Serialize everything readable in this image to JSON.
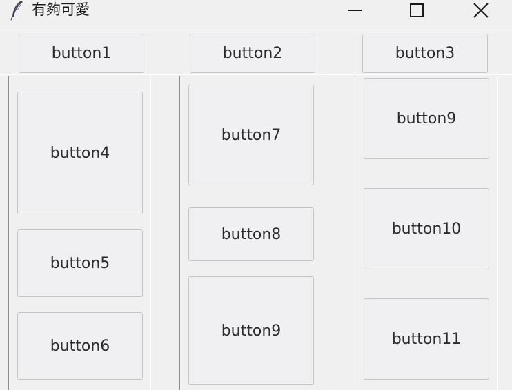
{
  "window": {
    "title": "有夠可愛",
    "app_icon": "feather-icon",
    "controls": [
      "minimize-icon",
      "maximize-icon",
      "close-icon"
    ]
  },
  "top_row": {
    "buttons": [
      "button1",
      "button2",
      "button3"
    ]
  },
  "columns": [
    {
      "buttons": [
        "button4",
        "button5",
        "button6"
      ]
    },
    {
      "buttons": [
        "button7",
        "button8",
        "button9"
      ]
    },
    {
      "buttons": [
        "button9",
        "button10",
        "button11"
      ]
    }
  ]
}
